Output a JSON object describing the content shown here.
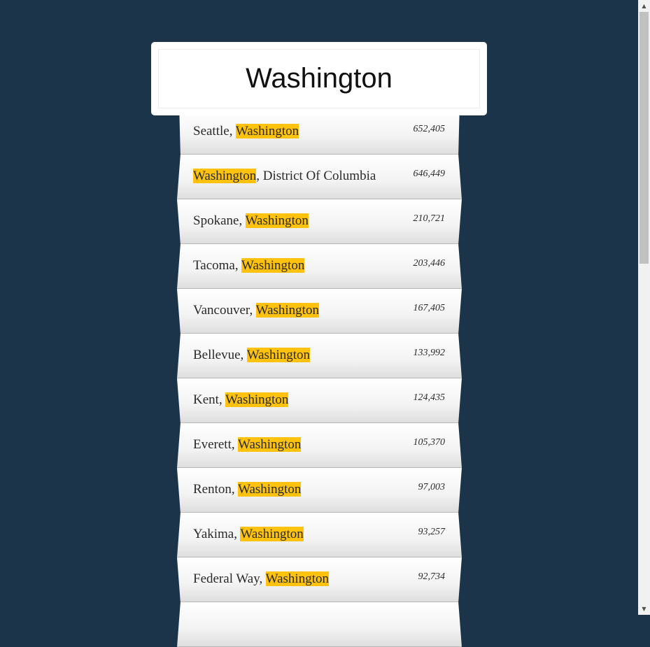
{
  "search": {
    "value": "Washington"
  },
  "highlight": "Washington",
  "colors": {
    "background": "#1b3449",
    "highlight": "#ffc20e"
  },
  "results": [
    {
      "city": "Seattle",
      "state": "Washington",
      "population": "652,405",
      "prefix": true
    },
    {
      "city": "District Of Columbia",
      "state": "Washington",
      "population": "646,449",
      "prefix": false
    },
    {
      "city": "Spokane",
      "state": "Washington",
      "population": "210,721",
      "prefix": true
    },
    {
      "city": "Tacoma",
      "state": "Washington",
      "population": "203,446",
      "prefix": true
    },
    {
      "city": "Vancouver",
      "state": "Washington",
      "population": "167,405",
      "prefix": true
    },
    {
      "city": "Bellevue",
      "state": "Washington",
      "population": "133,992",
      "prefix": true
    },
    {
      "city": "Kent",
      "state": "Washington",
      "population": "124,435",
      "prefix": true
    },
    {
      "city": "Everett",
      "state": "Washington",
      "population": "105,370",
      "prefix": true
    },
    {
      "city": "Renton",
      "state": "Washington",
      "population": "97,003",
      "prefix": true
    },
    {
      "city": "Yakima",
      "state": "Washington",
      "population": "93,257",
      "prefix": true
    },
    {
      "city": "Federal Way",
      "state": "Washington",
      "population": "92,734",
      "prefix": true
    }
  ],
  "scrollbar": {
    "up_icon": "triangle-up-icon",
    "down_icon": "triangle-down-icon",
    "up_glyph": "▲",
    "down_glyph": "▼"
  }
}
